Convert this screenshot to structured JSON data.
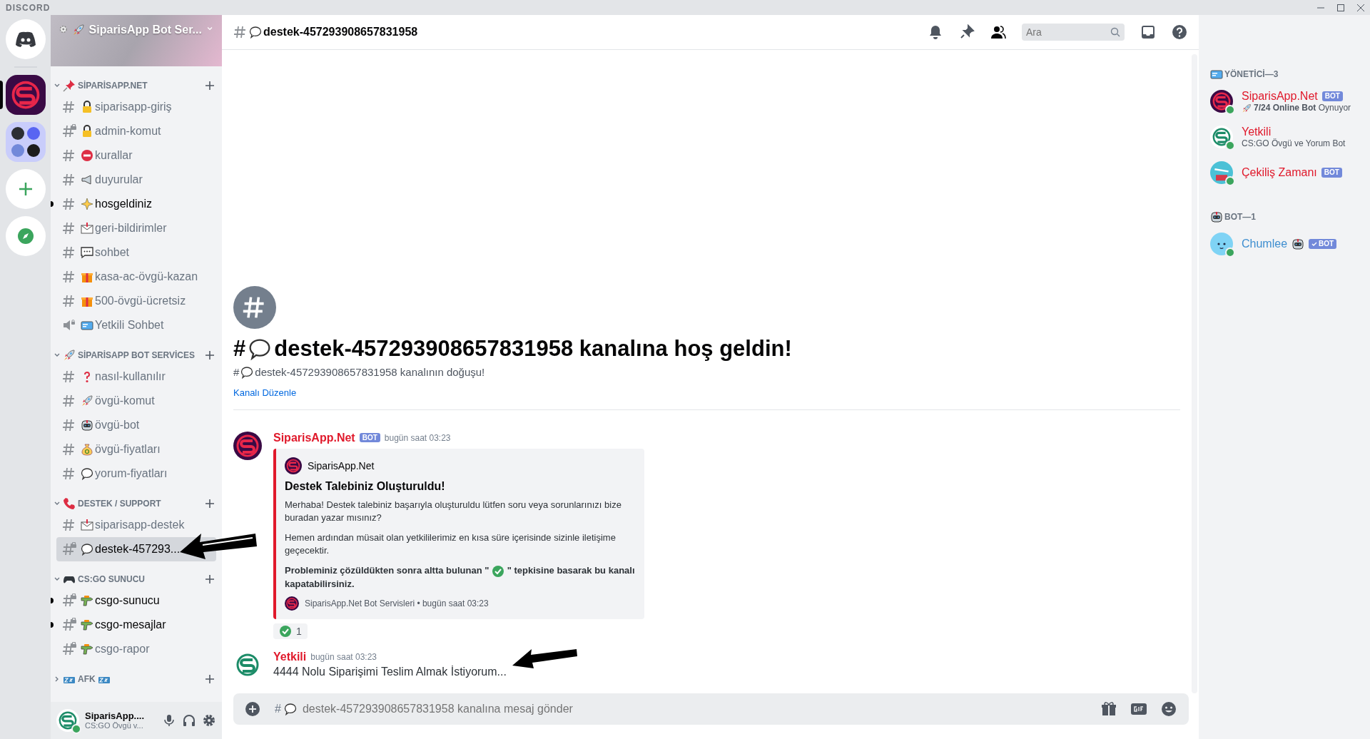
{
  "titlebar": {
    "brand": "DISCORD"
  },
  "servers": [
    {
      "kind": "home",
      "selected": false
    },
    {
      "kind": "server",
      "selected": true
    },
    {
      "kind": "folder",
      "selected": false
    },
    {
      "kind": "add",
      "selected": false
    },
    {
      "kind": "explore",
      "selected": false
    }
  ],
  "server_header": {
    "name": "SiparisApp Bot Ser..."
  },
  "categories": [
    {
      "name": "SİPARİSAPP.NET",
      "icon": {
        "kind": "pushpin"
      },
      "expanded": true,
      "channels": [
        {
          "name": "siparisapp-giriş",
          "kind": "text",
          "locked": false,
          "icon": {
            "kind": "lock"
          },
          "unread": false,
          "selected": false
        },
        {
          "name": "admin-komut",
          "kind": "text",
          "locked": true,
          "icon": {
            "kind": "lock"
          },
          "unread": false,
          "selected": false
        },
        {
          "name": "kurallar",
          "kind": "text",
          "locked": false,
          "icon": {
            "kind": "noentry"
          },
          "unread": false,
          "selected": false
        },
        {
          "name": "duyurular",
          "kind": "text",
          "locked": false,
          "icon": {
            "kind": "megaphone"
          },
          "unread": false,
          "selected": false
        },
        {
          "name": "hosgeldiniz",
          "kind": "text",
          "locked": false,
          "icon": {
            "kind": "sparkles"
          },
          "unread": true,
          "selected": false
        },
        {
          "name": "geri-bildirimler",
          "kind": "text",
          "locked": false,
          "icon": {
            "kind": "envelope"
          },
          "unread": false,
          "selected": false
        },
        {
          "name": "sohbet",
          "kind": "text",
          "locked": false,
          "icon": {
            "kind": "chat"
          },
          "unread": false,
          "selected": false
        },
        {
          "name": "kasa-ac-övgü-kazan",
          "kind": "text",
          "locked": false,
          "icon": {
            "kind": "gift"
          },
          "unread": false,
          "selected": false
        },
        {
          "name": "500-övgü-ücretsiz",
          "kind": "text",
          "locked": false,
          "icon": {
            "kind": "gift"
          },
          "unread": false,
          "selected": false
        },
        {
          "name": "Yetkili Sohbet",
          "kind": "voice",
          "locked": true,
          "icon": {
            "kind": "ticket"
          },
          "unread": false,
          "selected": false
        }
      ]
    },
    {
      "name": "SİPARİSAPP BOT SERVİCES",
      "icon": {
        "kind": "rocket"
      },
      "expanded": true,
      "channels": [
        {
          "name": "nasıl-kullanılır",
          "kind": "text",
          "locked": false,
          "icon": {
            "kind": "question"
          },
          "unread": false,
          "selected": false
        },
        {
          "name": "övgü-komut",
          "kind": "text",
          "locked": false,
          "icon": {
            "kind": "rocket"
          },
          "unread": false,
          "selected": false
        },
        {
          "name": "övgü-bot",
          "kind": "text",
          "locked": false,
          "icon": {
            "kind": "robot"
          },
          "unread": false,
          "selected": false
        },
        {
          "name": "övgü-fiyatları",
          "kind": "text",
          "locked": false,
          "icon": {
            "kind": "moneybag"
          },
          "unread": false,
          "selected": false
        },
        {
          "name": "yorum-fiyatları",
          "kind": "text",
          "locked": false,
          "icon": {
            "kind": "speech"
          },
          "unread": false,
          "selected": false
        }
      ]
    },
    {
      "name": "DESTEK / SUPPORT",
      "icon": {
        "kind": "phone"
      },
      "expanded": true,
      "channels": [
        {
          "name": "siparisapp-destek",
          "kind": "text",
          "locked": false,
          "icon": {
            "kind": "envelope"
          },
          "unread": false,
          "selected": false
        },
        {
          "name": "destek-457293...",
          "kind": "text",
          "locked": true,
          "icon": {
            "kind": "speech"
          },
          "unread": false,
          "selected": true
        }
      ]
    },
    {
      "name": "CS:GO SUNUCU",
      "icon": {
        "kind": "gamepad"
      },
      "expanded": true,
      "channels": [
        {
          "name": "csgo-sunucu",
          "kind": "text",
          "locked": true,
          "icon": {
            "kind": "gun"
          },
          "unread": true,
          "selected": false
        },
        {
          "name": "csgo-mesajlar",
          "kind": "text",
          "locked": true,
          "icon": {
            "kind": "gun"
          },
          "unread": true,
          "selected": false
        },
        {
          "name": "csgo-rapor",
          "kind": "text",
          "locked": true,
          "icon": {
            "kind": "gun"
          },
          "unread": false,
          "selected": false
        }
      ]
    },
    {
      "name": "AFK",
      "icon": {
        "kind": "zzz"
      },
      "icon_after": {
        "kind": "zzz"
      },
      "expanded": false
    }
  ],
  "user_panel": {
    "name": "SiparisApp....",
    "status": "CS:GO Övgü v..."
  },
  "channel_header": {
    "name": "destek-457293908657831958",
    "icon": {
      "kind": "speech"
    },
    "search": {
      "placeholder": "Ara"
    }
  },
  "welcome": {
    "hash": "#",
    "icon": {
      "kind": "speech"
    },
    "name": "destek-457293908657831958",
    "suffix": "kanalına hoş geldin!",
    "sub_hash": "#",
    "sub_icon": {
      "kind": "speech"
    },
    "subtitle": "destek-457293908657831958 kanalının doğuşu!",
    "edit_link": "Kanalı Düzenle"
  },
  "messages": [
    {
      "kind": "embed",
      "author": "SiparisApp.Net",
      "avatar": {
        "kind": "purple"
      },
      "tag": "BOT",
      "time": "bugün saat 03:23",
      "embed": {
        "author": "SiparisApp.Net",
        "title": "Destek Talebiniz Oluşturuldu!",
        "paragraphs": [
          "Merhaba! Destek talebiniz başarıyla oluşturuldu lütfen soru veya sorunlarınızı bize buradan yazar mısınız?",
          "Hemen ardından müsait olan yetkililerimiz en kısa süre içerisinde sizinle iletişime geçecektir."
        ],
        "bold_before": "Probleminiz çözüldükten sonra altta bulunan \"",
        "bold_after": "\" tepkisine basarak bu kanalı kapatabilirsiniz.",
        "footer": "SiparisApp.Net Bot Servisleri • bugün saat 03:23"
      },
      "reactions": [
        {
          "count": "1"
        }
      ]
    },
    {
      "kind": "text",
      "author": "Yetkili",
      "avatar": {
        "kind": "green"
      },
      "time": "bugün saat 03:23",
      "text": "4444 Nolu Siparişimi Teslim Almak İstiyorum..."
    }
  ],
  "composer": {
    "hash": "#",
    "icon": {
      "kind": "speech"
    },
    "placeholder": "destek-457293908657831958 kanalına mesaj gönder"
  },
  "member_groups": [
    {
      "title": "YÖNETİCİ—3",
      "icon": {
        "kind": "ticket"
      },
      "members": [
        {
          "name": "SiparisApp.Net",
          "color": "#e0192b",
          "avatar": {
            "kind": "purple"
          },
          "tag": "BOT",
          "verified": false,
          "activity": "**7/24 Online Bot** Oynuyor",
          "activity_icon": {
            "kind": "rocket"
          }
        },
        {
          "name": "Yetkili",
          "color": "#e0192b",
          "avatar": {
            "kind": "green"
          },
          "activity": "CS:GO Övgü ve Yorum Bot"
        },
        {
          "name": "Çekiliş Zamanı",
          "color": "#e0192b",
          "avatar": {
            "kind": "teal"
          },
          "tag": "BOT",
          "verified": false
        }
      ]
    },
    {
      "title": "BOT—1",
      "icon": {
        "kind": "robot"
      },
      "members": [
        {
          "name": "Chumlee",
          "color": "#3e8ed0",
          "avatar": {
            "kind": "blue"
          },
          "name_icon": {
            "kind": "robot"
          },
          "tag": "BOT",
          "verified": true
        }
      ]
    }
  ]
}
